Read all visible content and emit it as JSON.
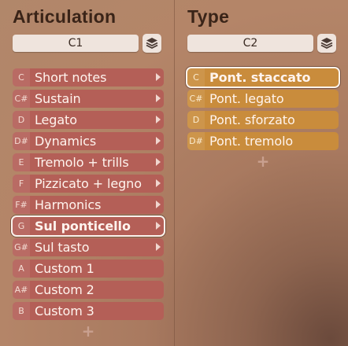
{
  "articulation": {
    "title": "Articulation",
    "selector_value": "C1",
    "add_label": "+",
    "items": [
      {
        "key": "C",
        "label": "Short notes",
        "has_submenu": true,
        "selected": false
      },
      {
        "key": "C#",
        "label": "Sustain",
        "has_submenu": true,
        "selected": false
      },
      {
        "key": "D",
        "label": "Legato",
        "has_submenu": true,
        "selected": false
      },
      {
        "key": "D#",
        "label": "Dynamics",
        "has_submenu": true,
        "selected": false
      },
      {
        "key": "E",
        "label": "Tremolo + trills",
        "has_submenu": true,
        "selected": false
      },
      {
        "key": "F",
        "label": "Pizzicato + legno",
        "has_submenu": true,
        "selected": false
      },
      {
        "key": "F#",
        "label": "Harmonics",
        "has_submenu": true,
        "selected": false
      },
      {
        "key": "G",
        "label": "Sul ponticello",
        "has_submenu": true,
        "selected": true
      },
      {
        "key": "G#",
        "label": "Sul tasto",
        "has_submenu": true,
        "selected": false
      },
      {
        "key": "A",
        "label": "Custom 1",
        "has_submenu": false,
        "selected": false
      },
      {
        "key": "A#",
        "label": "Custom 2",
        "has_submenu": false,
        "selected": false
      },
      {
        "key": "B",
        "label": "Custom 3",
        "has_submenu": false,
        "selected": false
      }
    ]
  },
  "type": {
    "title": "Type",
    "selector_value": "C2",
    "add_label": "+",
    "items": [
      {
        "key": "C",
        "label": "Pont. staccato",
        "selected": true
      },
      {
        "key": "C#",
        "label": "Pont. legato",
        "selected": false
      },
      {
        "key": "D",
        "label": "Pont. sforzato",
        "selected": false
      },
      {
        "key": "D#",
        "label": "Pont. tremolo",
        "selected": false
      }
    ]
  },
  "icons": {
    "layers": "layers-icon",
    "submenu": "chevron-right-icon"
  },
  "colors": {
    "articulation_row": "#b45f57",
    "type_row": "#c98c3c",
    "selected_outline": "#fbf3ec"
  }
}
